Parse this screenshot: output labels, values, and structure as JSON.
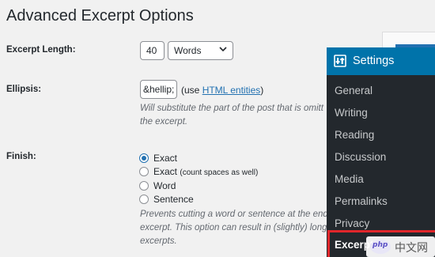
{
  "page": {
    "title": "Advanced Excerpt Options"
  },
  "excerpt_length": {
    "label": "Excerpt Length:",
    "value": "40",
    "unit": "Words"
  },
  "ellipsis": {
    "label": "Ellipsis:",
    "value": "&hellip;",
    "use_prefix": "(use ",
    "link_text": "HTML entities",
    "use_suffix": ")",
    "help_line1": "Will substitute the part of the post that is omitt",
    "help_line2": "the excerpt."
  },
  "finish": {
    "label": "Finish:",
    "options": [
      {
        "label": "Exact",
        "note": "",
        "checked": true
      },
      {
        "label": "Exact",
        "note": "(count spaces as well)",
        "checked": false
      },
      {
        "label": "Word",
        "note": "",
        "checked": false
      },
      {
        "label": "Sentence",
        "note": "",
        "checked": false
      }
    ],
    "help_line1": "Prevents cutting a word or sentence at the end",
    "help_line2": "excerpt. This option can result in (slightly) long",
    "help_line3": "excerpts."
  },
  "settings_menu": {
    "title": "Settings",
    "items": [
      "General",
      "Writing",
      "Reading",
      "Discussion",
      "Media",
      "Permalinks",
      "Privacy",
      "Excerpt"
    ],
    "active": "Excerpt"
  },
  "watermark": {
    "logo_text": "php",
    "text": "中文网"
  },
  "colors": {
    "accent": "#0073aa",
    "menu_bg": "#23282d",
    "highlight": "#e0262b",
    "link": "#2271b1"
  },
  "icons": {
    "menu_header": "settings-icon",
    "select": "chevron-down-icon"
  }
}
